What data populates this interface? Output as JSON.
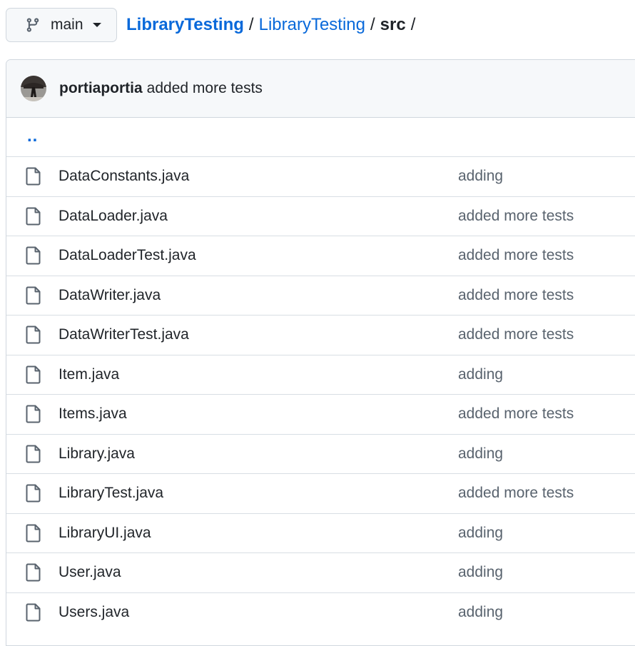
{
  "branch": {
    "label": "main",
    "icon": "git-branch-icon"
  },
  "breadcrumb": {
    "repo_owner": "LibraryTesting",
    "repo_name": "LibraryTesting",
    "current": "src",
    "separator": "/"
  },
  "latest_commit": {
    "author": "portiaportia",
    "message": "added more tests"
  },
  "parent_dir": "..",
  "files": [
    {
      "name": "DataConstants.java",
      "commit": "adding"
    },
    {
      "name": "DataLoader.java",
      "commit": "added more tests"
    },
    {
      "name": "DataLoaderTest.java",
      "commit": "added more tests"
    },
    {
      "name": "DataWriter.java",
      "commit": "added more tests"
    },
    {
      "name": "DataWriterTest.java",
      "commit": "added more tests"
    },
    {
      "name": "Item.java",
      "commit": "adding"
    },
    {
      "name": "Items.java",
      "commit": "added more tests"
    },
    {
      "name": "Library.java",
      "commit": "adding"
    },
    {
      "name": "LibraryTest.java",
      "commit": "added more tests"
    },
    {
      "name": "LibraryUI.java",
      "commit": "adding"
    },
    {
      "name": "User.java",
      "commit": "adding"
    },
    {
      "name": "Users.java",
      "commit": "adding"
    }
  ],
  "colors": {
    "link": "#0969da",
    "muted": "#59636e",
    "border": "#d0d7de",
    "header_bg": "#f6f8fa"
  }
}
